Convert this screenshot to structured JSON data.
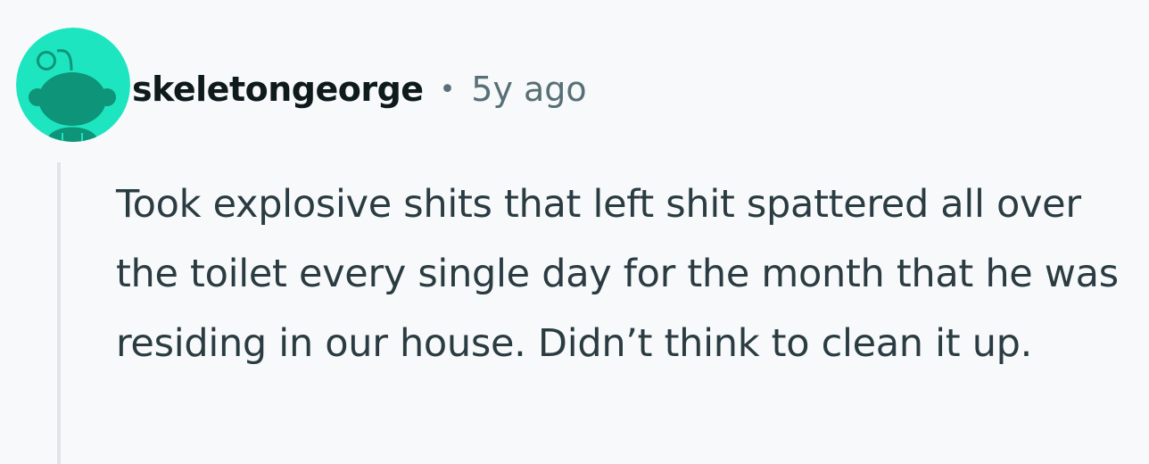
{
  "comment": {
    "username": "skeletongeorge",
    "separator": "•",
    "timestamp": "5y ago",
    "body": "Took explosive shits that left shit spattered all over the toilet every single day for the month that he was residing in our house. Didn’t think to clean it up.",
    "avatar_icon": "reddit-snoo-avatar-icon"
  },
  "colors": {
    "background": "#f7f9fa",
    "avatar_bg": "#1de5c0",
    "avatar_figure": "#0e9478",
    "username": "#0f1a1c",
    "meta": "#576f76",
    "body_text": "#2a3c42",
    "thread_line": "#dfe5e8"
  }
}
